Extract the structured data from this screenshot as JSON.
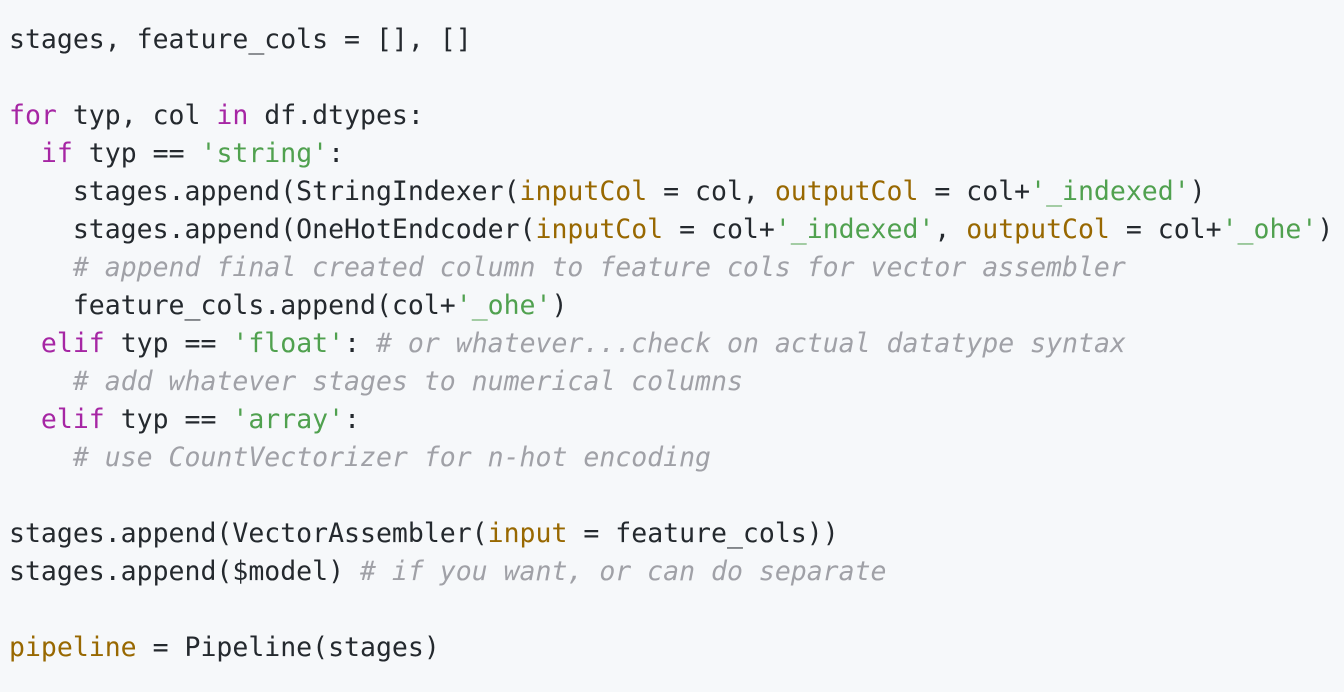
{
  "colors": {
    "background": "#f6f8fa",
    "plain": "#24292e",
    "keyword": "#a626a4",
    "string": "#50a14f",
    "comment": "#a0a1a7",
    "argument": "#986801"
  },
  "code": {
    "lines": [
      [
        {
          "t": "plain",
          "v": "stages, feature_cols = [], []"
        }
      ],
      [],
      [
        {
          "t": "kw",
          "v": "for"
        },
        {
          "t": "plain",
          "v": " typ, col "
        },
        {
          "t": "kw",
          "v": "in"
        },
        {
          "t": "plain",
          "v": " df.dtypes:"
        }
      ],
      [
        {
          "t": "plain",
          "v": "  "
        },
        {
          "t": "kw",
          "v": "if"
        },
        {
          "t": "plain",
          "v": " typ == "
        },
        {
          "t": "str",
          "v": "'string'"
        },
        {
          "t": "plain",
          "v": ":"
        }
      ],
      [
        {
          "t": "plain",
          "v": "    stages.append(StringIndexer("
        },
        {
          "t": "arg",
          "v": "inputCol"
        },
        {
          "t": "plain",
          "v": " = col, "
        },
        {
          "t": "arg",
          "v": "outputCol"
        },
        {
          "t": "plain",
          "v": " = col+"
        },
        {
          "t": "str",
          "v": "'_indexed'"
        },
        {
          "t": "plain",
          "v": ")"
        }
      ],
      [
        {
          "t": "plain",
          "v": "    stages.append(OneHotEndcoder("
        },
        {
          "t": "arg",
          "v": "inputCol"
        },
        {
          "t": "plain",
          "v": " = col+"
        },
        {
          "t": "str",
          "v": "'_indexed'"
        },
        {
          "t": "plain",
          "v": ", "
        },
        {
          "t": "arg",
          "v": "outputCol"
        },
        {
          "t": "plain",
          "v": " = col+"
        },
        {
          "t": "str",
          "v": "'_ohe'"
        },
        {
          "t": "plain",
          "v": ")"
        }
      ],
      [
        {
          "t": "plain",
          "v": "    "
        },
        {
          "t": "cm",
          "v": "# append final created column to feature cols for vector assembler"
        }
      ],
      [
        {
          "t": "plain",
          "v": "    feature_cols.append(col+"
        },
        {
          "t": "str",
          "v": "'_ohe'"
        },
        {
          "t": "plain",
          "v": ")"
        }
      ],
      [
        {
          "t": "plain",
          "v": "  "
        },
        {
          "t": "kw",
          "v": "elif"
        },
        {
          "t": "plain",
          "v": " typ == "
        },
        {
          "t": "str",
          "v": "'float'"
        },
        {
          "t": "plain",
          "v": ": "
        },
        {
          "t": "cm",
          "v": "# or whatever...check on actual datatype syntax"
        }
      ],
      [
        {
          "t": "plain",
          "v": "    "
        },
        {
          "t": "cm",
          "v": "# add whatever stages to numerical columns"
        }
      ],
      [
        {
          "t": "plain",
          "v": "  "
        },
        {
          "t": "kw",
          "v": "elif"
        },
        {
          "t": "plain",
          "v": " typ == "
        },
        {
          "t": "str",
          "v": "'array'"
        },
        {
          "t": "plain",
          "v": ":"
        }
      ],
      [
        {
          "t": "plain",
          "v": "    "
        },
        {
          "t": "cm",
          "v": "# use CountVectorizer for n-hot encoding"
        }
      ],
      [],
      [
        {
          "t": "plain",
          "v": "stages.append(VectorAssembler("
        },
        {
          "t": "arg",
          "v": "input"
        },
        {
          "t": "plain",
          "v": " = feature_cols))"
        }
      ],
      [
        {
          "t": "plain",
          "v": "stages.append($model) "
        },
        {
          "t": "cm",
          "v": "# if you want, or can do separate"
        }
      ],
      [],
      [
        {
          "t": "arg",
          "v": "pipeline"
        },
        {
          "t": "plain",
          "v": " = Pipeline(stages)"
        }
      ]
    ]
  }
}
